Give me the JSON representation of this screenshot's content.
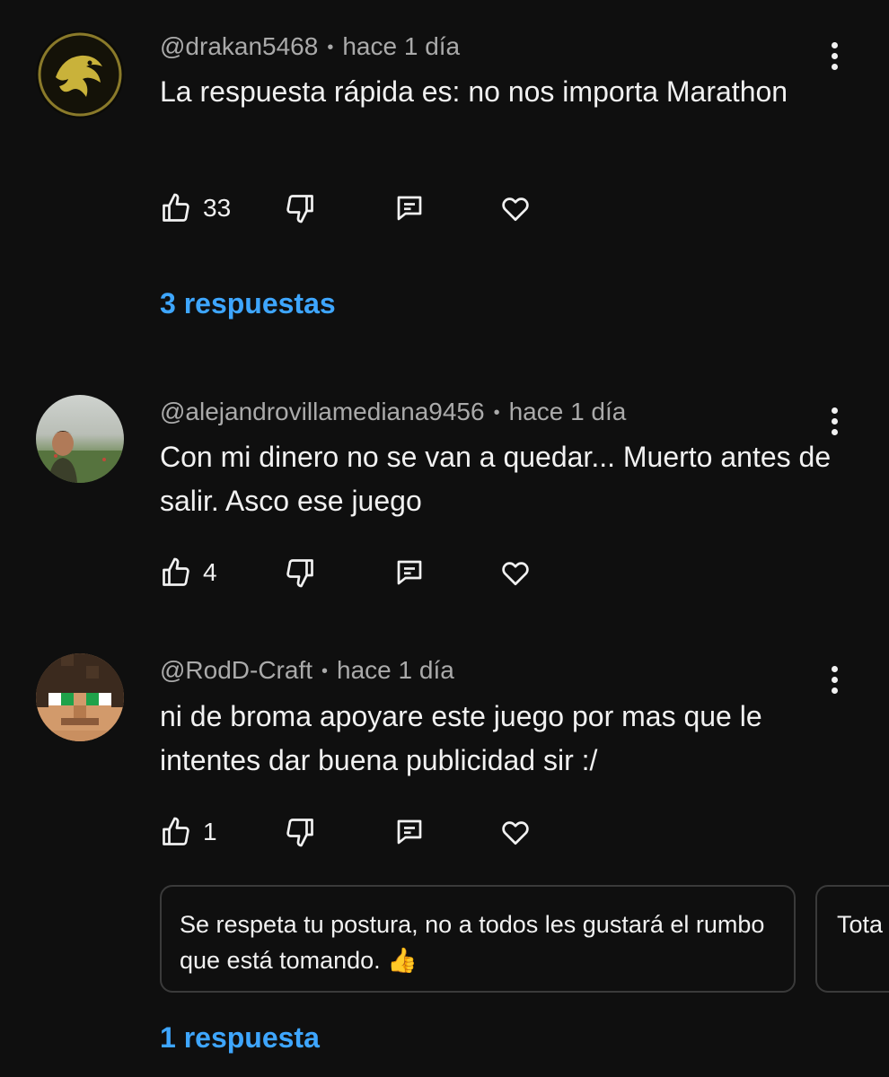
{
  "comments": [
    {
      "handle": "@drakan5468",
      "time": "hace 1 día",
      "text": "La respuesta rápida es: no nos importa Marathon",
      "likes": "33",
      "replies_label": "3 respuestas",
      "avatar_icon": "dragon-logo-avatar"
    },
    {
      "handle": "@alejandrovillamediana9456",
      "time": "hace 1 día",
      "text": "Con mi dinero no se van a quedar... Muerto antes de salir. Asco ese juego",
      "likes": "4",
      "avatar_icon": "photo-avatar"
    },
    {
      "handle": "@RodD-Craft",
      "time": "hace 1 día",
      "text": "ni de broma apoyare este juego por mas que le intentes dar buena publicidad sir :/",
      "likes": "1",
      "replies_label": "1 respuesta",
      "avatar_icon": "pixel-face-avatar",
      "reply_previews": [
        "Se respeta tu postura, no a todos les gustará el rumbo que está tomando. 👍",
        "Tota gast"
      ]
    }
  ],
  "separator": "•",
  "colors": {
    "background": "#0f0f0f",
    "link": "#3ea6ff",
    "meta": "#aaaaaa"
  },
  "icons": [
    "thumbs-up-icon",
    "thumbs-down-icon",
    "reply-comment-icon",
    "heart-icon",
    "more-vert-icon"
  ]
}
